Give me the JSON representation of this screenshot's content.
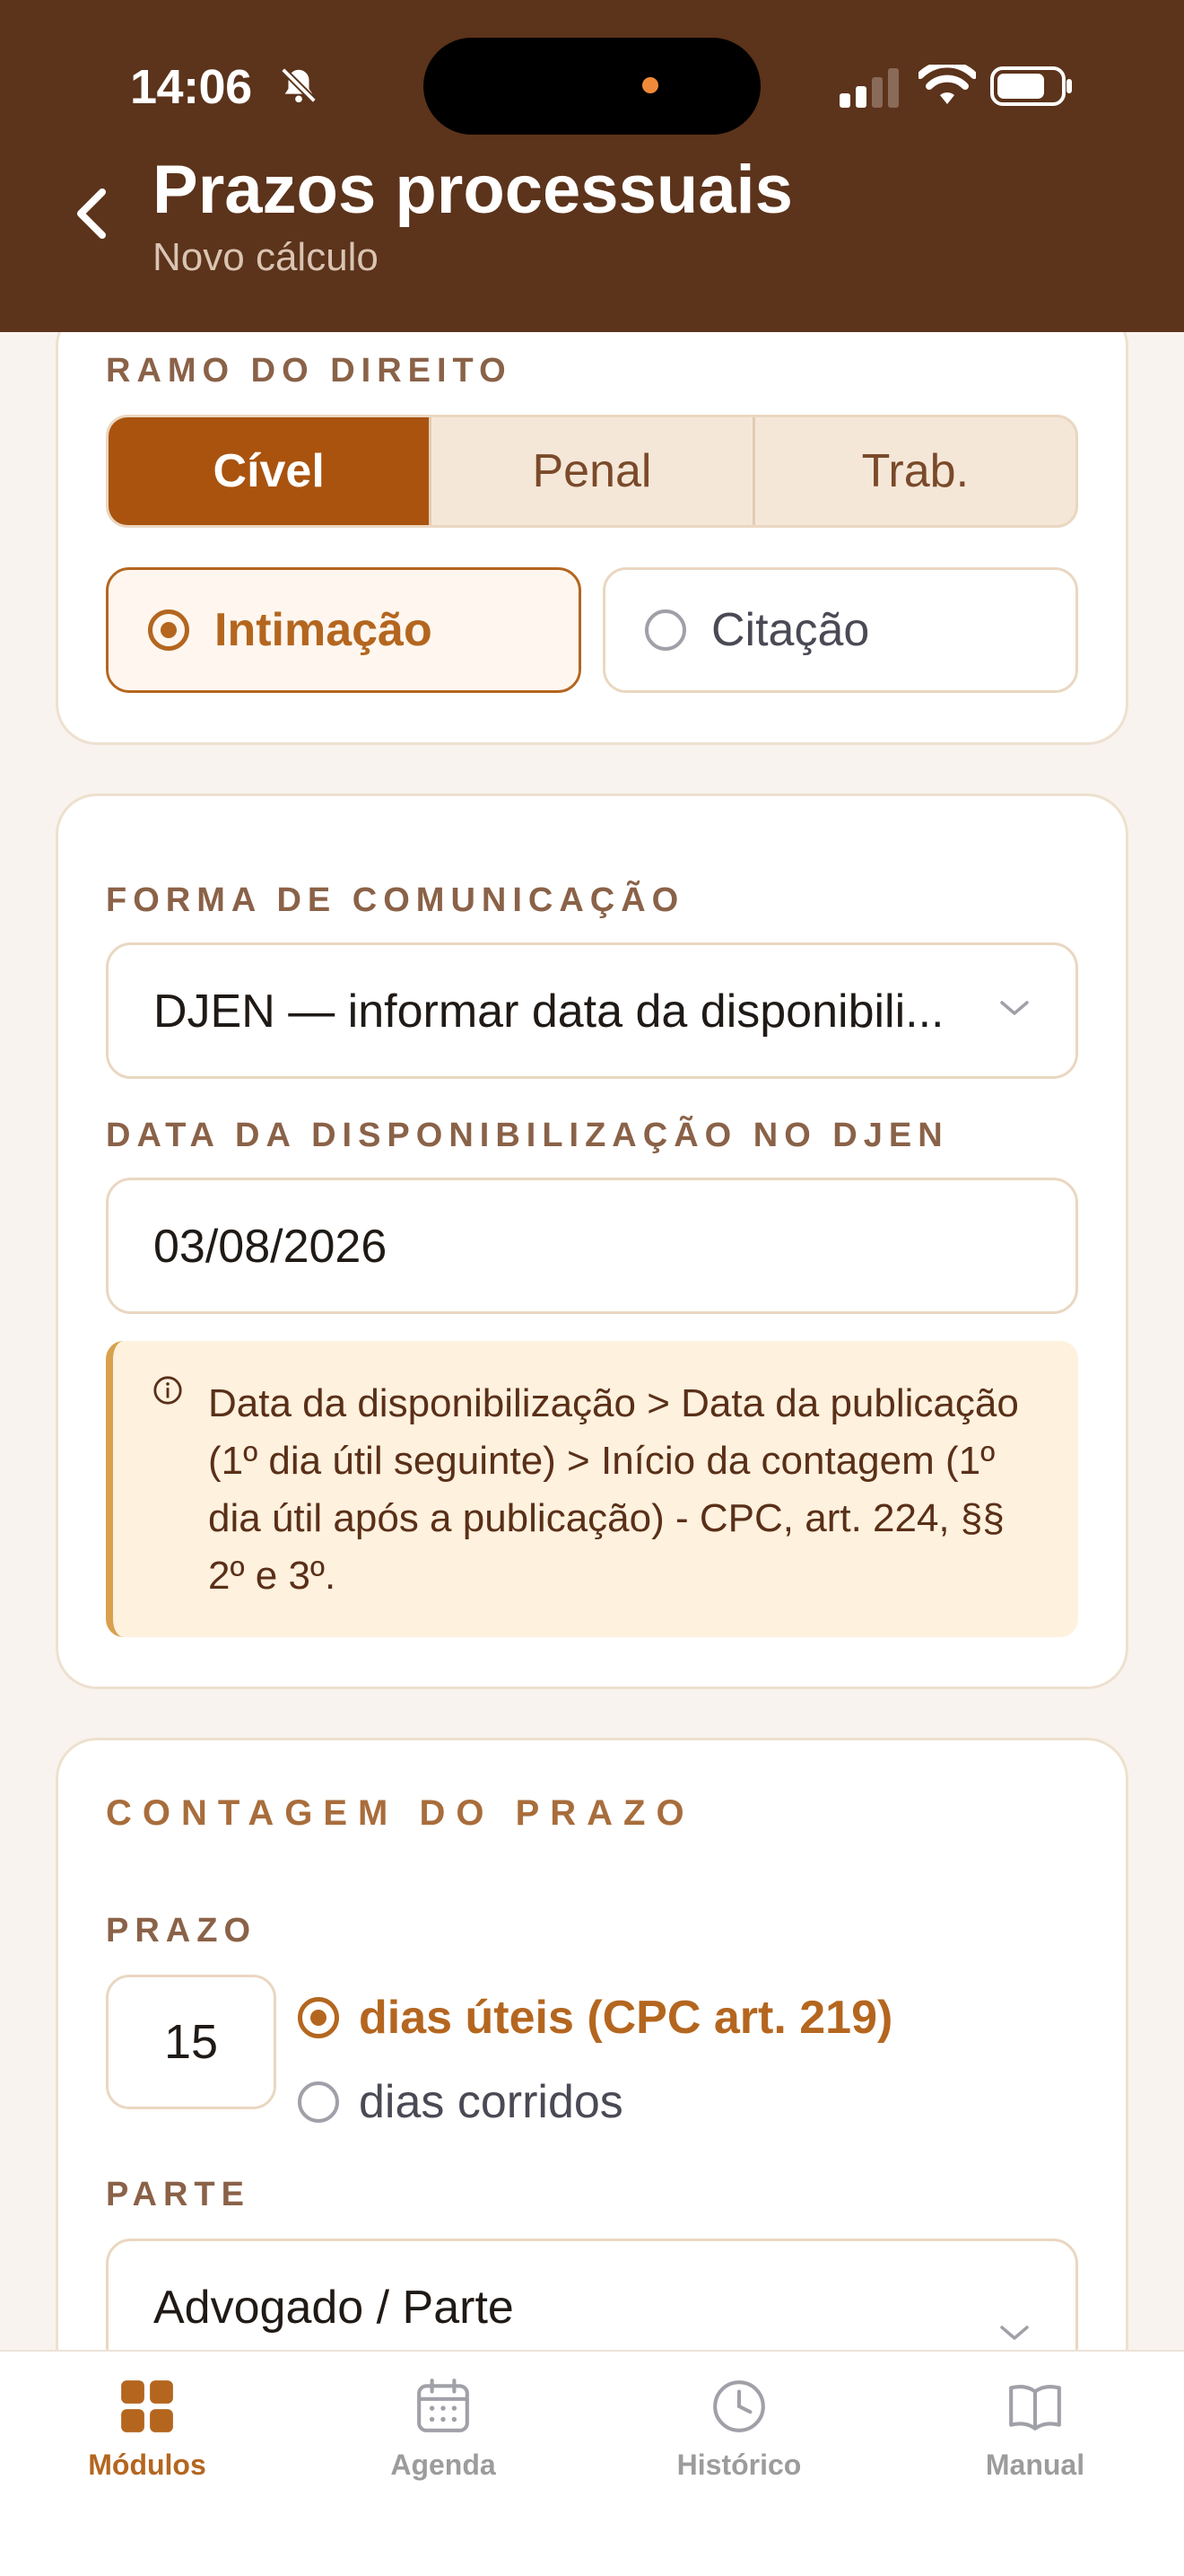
{
  "status_bar": {
    "time": "14:06"
  },
  "header": {
    "title": "Prazos processuais",
    "subtitle": "Novo cálculo"
  },
  "card1": {
    "label": "RAMO DO DIREITO",
    "segments": [
      "Cível",
      "Penal",
      "Trab."
    ],
    "selected_segment": "Cível",
    "options": [
      "Intimação",
      "Citação"
    ],
    "selected_option": "Intimação"
  },
  "card2": {
    "forma_label": "FORMA DE COMUNICAÇÃO",
    "forma_value": "DJEN — informar data da disponibili...",
    "data_label": "DATA DA DISPONIBILIZAÇÃO NO DJEN",
    "data_value": "03/08/2026",
    "info_text": "Data da disponibilização > Data da publicação (1º dia útil seguinte) > Início da contagem (1º dia útil após a publicação) - CPC, art. 224, §§ 2º e 3º."
  },
  "card3": {
    "section_title": "CONTAGEM DO PRAZO",
    "prazo_label": "PRAZO",
    "prazo_value": "15",
    "options": [
      "dias úteis (CPC art. 219)",
      "dias corridos"
    ],
    "selected_option": "dias úteis (CPC art. 219)",
    "parte_label": "PARTE",
    "parte_value": "Advogado / Parte"
  },
  "tabbar": {
    "tabs": [
      {
        "label": "Módulos",
        "icon": "grid-icon",
        "active": true
      },
      {
        "label": "Agenda",
        "icon": "calendar-icon",
        "active": false
      },
      {
        "label": "Histórico",
        "icon": "clock-icon",
        "active": false
      },
      {
        "label": "Manual",
        "icon": "book-icon",
        "active": false
      }
    ]
  },
  "colors": {
    "header": "#5c331b",
    "accent": "#a9530e",
    "background": "#f8f3ee"
  }
}
